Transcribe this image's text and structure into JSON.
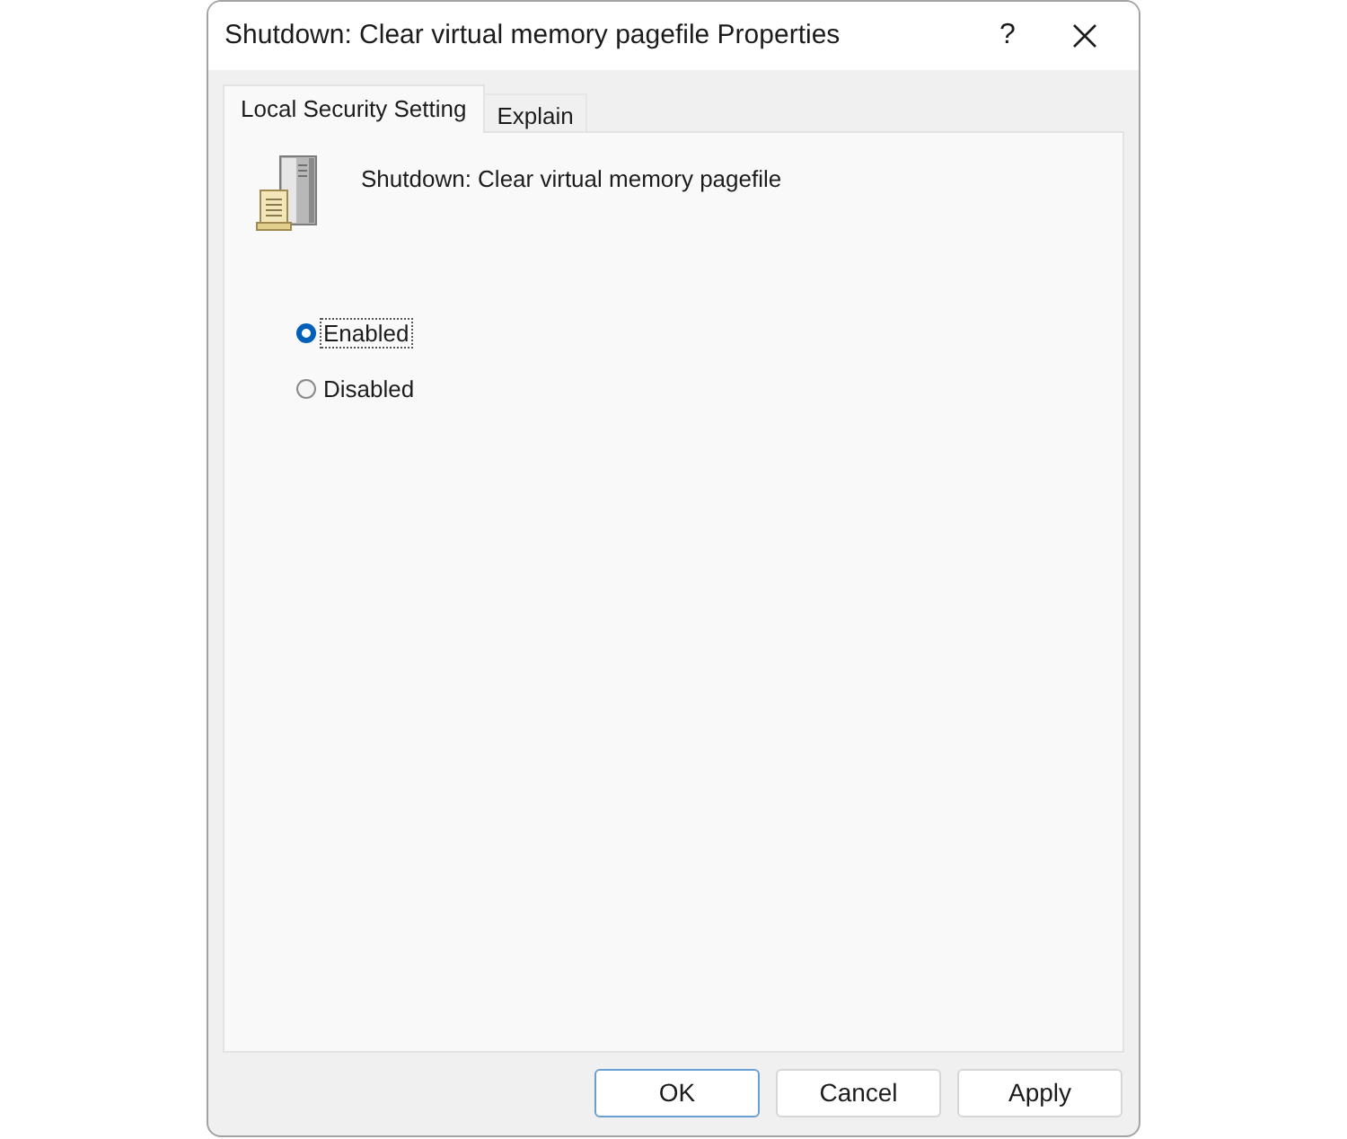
{
  "window": {
    "title": "Shutdown: Clear virtual memory pagefile Properties",
    "help_button": "?"
  },
  "tabs": [
    {
      "label": "Local Security Setting",
      "selected": true
    },
    {
      "label": "Explain",
      "selected": false
    }
  ],
  "policy": {
    "name": "Shutdown: Clear virtual memory pagefile"
  },
  "options": [
    {
      "label": "Enabled",
      "selected": true,
      "focused": true
    },
    {
      "label": "Disabled",
      "selected": false,
      "focused": false
    }
  ],
  "buttons": [
    {
      "label": "OK",
      "default": true
    },
    {
      "label": "Cancel",
      "default": false
    },
    {
      "label": "Apply",
      "default": false
    }
  ]
}
